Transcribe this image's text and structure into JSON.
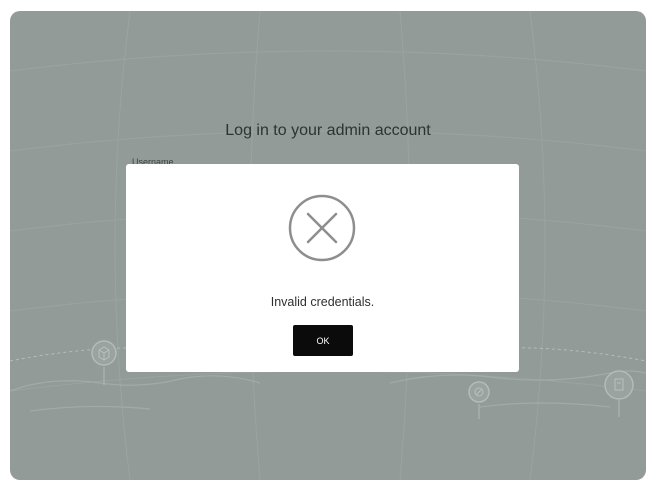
{
  "login": {
    "title": "Log in to your admin account",
    "username_label": "Username"
  },
  "dialog": {
    "icon": "error-circle-x-icon",
    "message": "Invalid credentials.",
    "ok_label": "OK"
  },
  "colors": {
    "overlay": "#929b98",
    "dialog_background": "#ffffff",
    "button_background": "#0b0b0b",
    "icon_stroke": "#8e8e8e"
  }
}
